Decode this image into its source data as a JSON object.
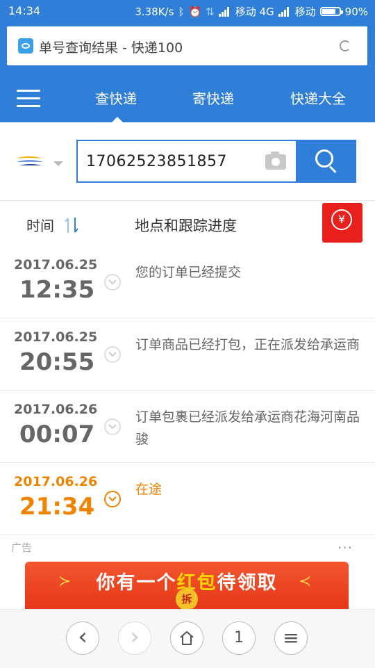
{
  "status_bar": {
    "time": "14:34",
    "net_speed": "3.38K/s",
    "carrier1": "移动 4G",
    "carrier2": "移动",
    "battery": "90%",
    "battery_level": 0.9
  },
  "browser": {
    "page_title": "单号查询结果 - 快递100"
  },
  "nav": {
    "tabs": [
      {
        "label": "查快递",
        "active": true
      },
      {
        "label": "寄快递",
        "active": false
      },
      {
        "label": "快递大全",
        "active": false
      }
    ]
  },
  "search": {
    "tracking_number": "17062523851857"
  },
  "table_header": {
    "time_label": "时间",
    "track_label": "地点和跟踪进度",
    "redpacket_symbol": "¥"
  },
  "timeline": [
    {
      "date": "2017.06.25",
      "time": "12:35",
      "text": "您的订单已经提交",
      "latest": false
    },
    {
      "date": "2017.06.25",
      "time": "20:55",
      "text": "订单商品已经打包，正在派发给承运商",
      "latest": false
    },
    {
      "date": "2017.06.26",
      "time": "00:07",
      "text": "订单包裹已经派发给承运商花海河南品骏",
      "latest": false
    },
    {
      "date": "2017.06.26",
      "time": "21:34",
      "text": "在途",
      "latest": true
    }
  ],
  "ad": {
    "label": "广告",
    "more": "···",
    "banner_pre": "你有一个",
    "banner_hl": "红包",
    "banner_post": "待领取",
    "open_label": "拆"
  },
  "bottom_bar": {
    "back": "‹",
    "forward": "›",
    "tabs_count": "1",
    "menu": "≡"
  },
  "colors": {
    "brand_blue": "#2f7fd9",
    "status_orange": "#f08300",
    "red": "#e8201e"
  }
}
